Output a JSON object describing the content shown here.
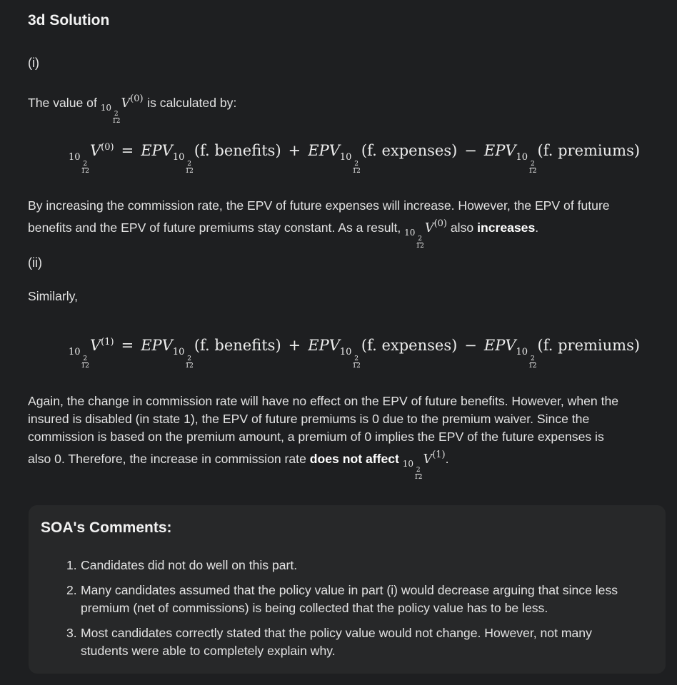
{
  "title": "3d Solution",
  "part_i": {
    "label": "(i)",
    "intro_before": "The value of",
    "intro_after": "is calculated by:",
    "explanation_line1": "By increasing the commission rate, the EPV of future expenses will increase. However, the EPV of future",
    "explanation_line2_before": "benefits and the EPV of future premiums stay constant. As a result,",
    "explanation_line2_mid": "also",
    "explanation_bold": "increases",
    "explanation_end": "."
  },
  "part_ii": {
    "label": "(ii)",
    "intro": "Similarly,",
    "line1": "Again, the change in commission rate will have no effect on the EPV of future benefits. However, when the",
    "line2": "insured is disabled (in state 1), the EPV of future premiums is 0 due to the premium waiver. Since the",
    "line3": "commission is based on the premium amount, a premium of 0 implies the EPV of the future expenses is",
    "line4_before": "also 0. Therefore, the increase in commission rate",
    "line4_bold": "does not affect",
    "line4_end": "."
  },
  "math": {
    "V": "V",
    "time_whole": "10",
    "time_num": "2",
    "time_den": "12",
    "state0": "(0)",
    "state1": "(1)",
    "equals": "=",
    "plus": "+",
    "minus": "−",
    "epv": "EPV",
    "benefits": "(f. benefits)",
    "expenses": "(f. expenses)",
    "premiums": "(f. premiums)"
  },
  "comments": {
    "title": "SOA's Comments:",
    "items": [
      {
        "num": "1.",
        "text": "Candidates did not do well on this part."
      },
      {
        "num": "2.",
        "text": "Many candidates assumed that the policy value in part (i) would decrease arguing that since less premium (net of commissions) is being collected that the policy value has to be less."
      },
      {
        "num": "3.",
        "text": "Most candidates correctly stated that the policy value would not change. However, not many students were able to completely explain why."
      }
    ]
  }
}
